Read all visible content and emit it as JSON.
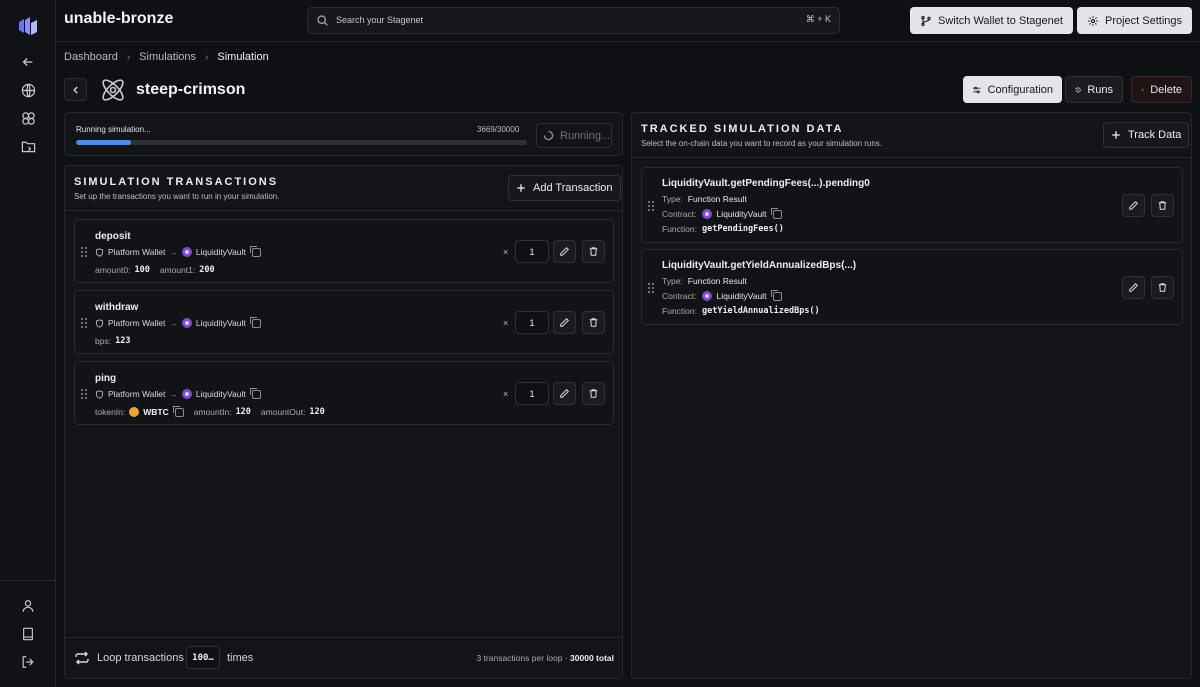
{
  "header": {
    "project_name": "unable-bronze",
    "search_placeholder": "Search your Stagenet",
    "search_shortcut": "⌘ + K",
    "switch_wallet_label": "Switch Wallet to Stagenet",
    "project_settings_label": "Project Settings"
  },
  "sidebar": {
    "icons": [
      "back-arrow-icon",
      "globe-icon",
      "simulations-icon",
      "folder-icon",
      "user-icon",
      "book-icon",
      "logout-icon"
    ]
  },
  "breadcrumb": [
    "Dashboard",
    "Simulations",
    "Simulation"
  ],
  "simulation": {
    "title": "steep-crimson",
    "configuration_label": "Configuration",
    "runs_label": "Runs",
    "delete_label": "Delete"
  },
  "progress": {
    "status": "Running simulation...",
    "count": "3669/30000",
    "fraction": 0.1223,
    "button_label": "Running..."
  },
  "transactions": {
    "title": "SIMULATION TRANSACTIONS",
    "subtitle": "Set up the transactions you want to run in your simulation.",
    "add_label": "Add Transaction",
    "items": [
      {
        "name": "deposit",
        "from": "Platform Wallet",
        "to": "LiquidityVault",
        "times_symbol": "×",
        "count": "1",
        "params": [
          {
            "key": "amount0:",
            "value": "100"
          },
          {
            "key": "amount1:",
            "value": "200"
          }
        ]
      },
      {
        "name": "withdraw",
        "from": "Platform Wallet",
        "to": "LiquidityVault",
        "times_symbol": "×",
        "count": "1",
        "params": [
          {
            "key": "bps:",
            "value": "123"
          }
        ]
      },
      {
        "name": "ping",
        "from": "Platform Wallet",
        "to": "LiquidityVault",
        "times_symbol": "×",
        "count": "1",
        "token_key": "tokenIn:",
        "token_value": "WBTC",
        "params": [
          {
            "key": "amountIn:",
            "value": "120"
          },
          {
            "key": "amountOut:",
            "value": "120"
          }
        ]
      }
    ],
    "loop_label": "Loop transactions",
    "loop_value": "100…",
    "loop_times": "times",
    "stats_prefix": "3 transactions per loop · ",
    "stats_total": "30000 total"
  },
  "tracked": {
    "title": "TRACKED SIMULATION DATA",
    "subtitle": "Select the on-chain data you want to record as your simulation runs.",
    "track_label": "Track Data",
    "items": [
      {
        "name": "LiquidityVault.getPendingFees(...).pending0",
        "type_key": "Type:",
        "type_value": "Function Result",
        "contract_key": "Contract:",
        "contract_value": "LiquidityVault",
        "function_key": "Function:",
        "function_value": "getPendingFees()"
      },
      {
        "name": "LiquidityVault.getYieldAnnualizedBps(...)",
        "type_key": "Type:",
        "type_value": "Function Result",
        "contract_key": "Contract:",
        "contract_value": "LiquidityVault",
        "function_key": "Function:",
        "function_value": "getYieldAnnualizedBps()"
      }
    ]
  }
}
